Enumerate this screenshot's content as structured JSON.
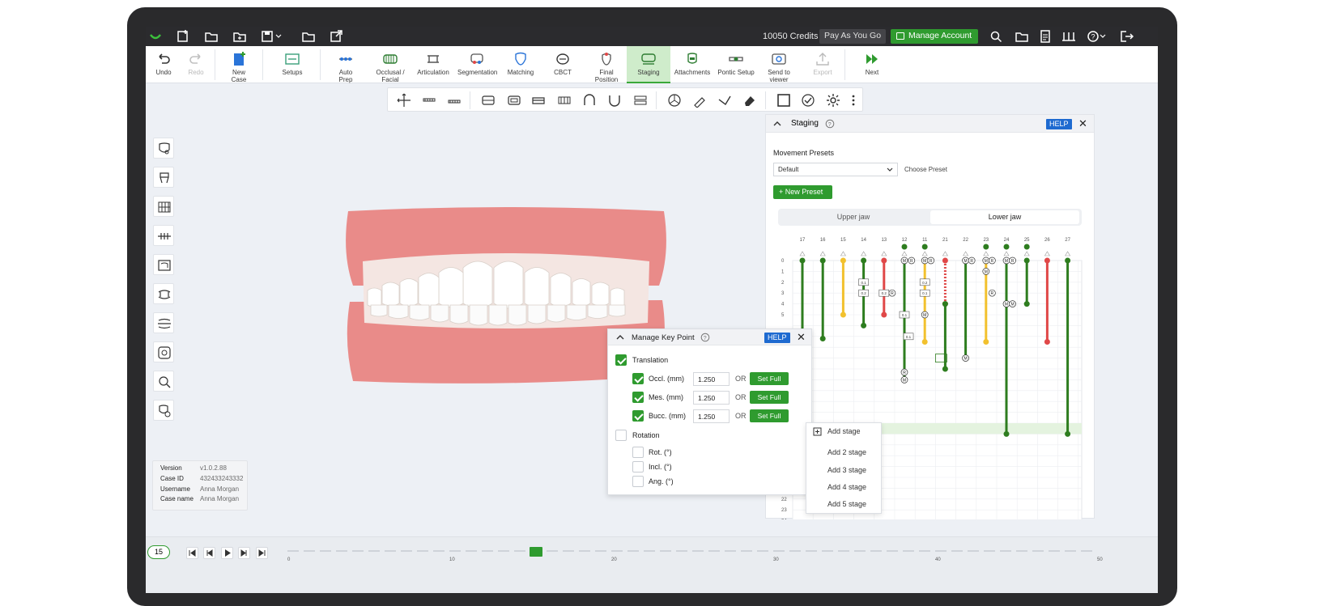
{
  "titlebar": {
    "credits": "10050 Credits",
    "separator": "|",
    "plan_label": "Pay As You Go",
    "manage_account": "Manage Account"
  },
  "ribbon": {
    "items": [
      {
        "label": "Undo",
        "icon": "undo-icon"
      },
      {
        "label": "Redo",
        "icon": "redo-icon"
      },
      {
        "label": "New Case",
        "icon": "new-case-icon"
      },
      {
        "label": "Setups",
        "icon": "setups-icon"
      },
      {
        "label": "Auto Prep",
        "icon": "auto-prep-icon"
      },
      {
        "label": "Occlusal / Facial",
        "icon": "occlusal-facial-icon"
      },
      {
        "label": "Articulation",
        "icon": "articulation-icon"
      },
      {
        "label": "Segmentation",
        "icon": "segmentation-icon"
      },
      {
        "label": "Matching",
        "icon": "matching-icon"
      },
      {
        "label": "CBCT",
        "icon": "cbct-icon"
      },
      {
        "label": "Final Position",
        "icon": "final-position-icon"
      },
      {
        "label": "Staging",
        "icon": "staging-icon"
      },
      {
        "label": "Attachments",
        "icon": "attachments-icon"
      },
      {
        "label": "Pontic Setup",
        "icon": "pontic-setup-icon"
      },
      {
        "label": "Send to viewer",
        "icon": "send-to-viewer-icon"
      },
      {
        "label": "Export",
        "icon": "export-icon"
      },
      {
        "label": "Next",
        "icon": "next-icon"
      }
    ]
  },
  "info": {
    "version_label": "Version",
    "version": "v1.0.2.88",
    "caseid_label": "Case ID",
    "caseid": "432433243332",
    "username_label": "Username",
    "username": "Anna Morgan",
    "casename_label": "Case name",
    "casename": "Anna Morgan"
  },
  "staging": {
    "title": "Staging",
    "help": "HELP",
    "presets_heading": "Movement Presets",
    "preset_value": "Default",
    "choose_preset": "Choose Preset",
    "new_preset": "New Preset",
    "tabs": [
      "Upper jaw",
      "Lower jaw"
    ],
    "selected_tab": "Lower jaw",
    "teeth": [
      "17",
      "16",
      "15",
      "14",
      "13",
      "12",
      "11",
      "21",
      "22",
      "23",
      "24",
      "25",
      "26",
      "27"
    ],
    "rows": [
      "0",
      "1",
      "2",
      "3",
      "4",
      "5",
      "22",
      "23",
      "24"
    ],
    "badge_labels": {
      "move": "M",
      "rot": "R",
      "step": "0.1",
      "step2": "0.2"
    }
  },
  "key_point": {
    "title": "Manage Key Point",
    "help": "HELP",
    "translation_label": "Translation",
    "translation_checked": true,
    "fields": [
      {
        "label": "Occl. (mm)",
        "value": "1.250",
        "or": "OR",
        "button": "Set Full",
        "checked": true
      },
      {
        "label": "Mes. (mm)",
        "value": "1.250",
        "or": "OR",
        "button": "Set Full",
        "checked": true
      },
      {
        "label": "Bucc. (mm)",
        "value": "1.250",
        "or": "OR",
        "button": "Set Full",
        "checked": true
      }
    ],
    "rotation_label": "Rotation",
    "rotation_checked": false,
    "rotation_fields": [
      {
        "label": "Rot. (°)",
        "checked": false
      },
      {
        "label": "Incl. (°)",
        "checked": false
      },
      {
        "label": "Ang. (°)",
        "checked": false
      }
    ]
  },
  "context_menu": {
    "items": [
      "Add stage",
      "Add 2 stage",
      "Add 3 stage",
      "Add 4 stage",
      "Add 5 stage"
    ]
  },
  "timeline": {
    "current_step": "15",
    "marker": "15",
    "ticks": [
      "0",
      "10",
      "20",
      "30",
      "40",
      "50"
    ]
  },
  "colors": {
    "accent": "#2f9b2f",
    "help_blue": "#1e6ad0",
    "bar_green": "#2e7d1f",
    "bar_yellow": "#f2c12e",
    "bar_red": "#e04848"
  }
}
